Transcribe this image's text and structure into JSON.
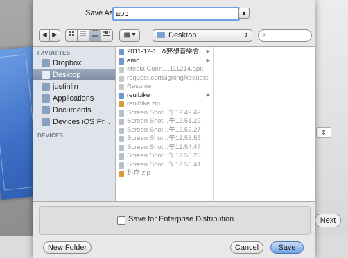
{
  "dialog": {
    "save_as_label": "Save As:",
    "save_as_value": "app",
    "expand_icon": "▲"
  },
  "toolbar": {
    "back": "◀",
    "forward": "▶",
    "arrange": "▦ ▾",
    "location": "Desktop",
    "location_chevron": "⇕",
    "search_icon": "⌕"
  },
  "sidebar": {
    "favorites_heading": "FAVORITES",
    "devices_heading": "DEVICES",
    "items": [
      {
        "label": "Dropbox",
        "icon": "folder-icon"
      },
      {
        "label": "Desktop",
        "icon": "desktop-icon",
        "selected": true
      },
      {
        "label": "justinlin",
        "icon": "home-icon"
      },
      {
        "label": "Applications",
        "icon": "applications-icon"
      },
      {
        "label": "Documents",
        "icon": "documents-icon"
      },
      {
        "label": "Devices   iOS Pr...",
        "icon": "folder-icon"
      }
    ]
  },
  "files": [
    {
      "name": "2011-12-1...&夢想音樂會",
      "type": "folder",
      "arrow": "▶"
    },
    {
      "name": "emc",
      "type": "folder",
      "arrow": "▶"
    },
    {
      "name": "Media Conn....111214.apk",
      "type": "file",
      "disabled": true
    },
    {
      "name": "request.certSigningRequest",
      "type": "file",
      "disabled": true
    },
    {
      "name": "Resume",
      "type": "file",
      "disabled": true
    },
    {
      "name": "reuibike",
      "type": "folder",
      "arrow": "▶"
    },
    {
      "name": "reuibike.zip",
      "type": "zip",
      "disabled": true
    },
    {
      "name": "Screen Shot...午12.49.42",
      "type": "img",
      "disabled": true
    },
    {
      "name": "Screen Shot...午12.51.22",
      "type": "img",
      "disabled": true
    },
    {
      "name": "Screen Shot...午12.52.27",
      "type": "img",
      "disabled": true
    },
    {
      "name": "Screen Shot...午12.53.55",
      "type": "img",
      "disabled": true
    },
    {
      "name": "Screen Shot...午12.54.47",
      "type": "img",
      "disabled": true
    },
    {
      "name": "Screen Shot...午12.55.23",
      "type": "img",
      "disabled": true
    },
    {
      "name": "Screen Shot...午12.55.41",
      "type": "img",
      "disabled": true
    },
    {
      "name": "封存.zip",
      "type": "zip",
      "disabled": true
    }
  ],
  "options": {
    "enterprise_label": "Save for Enterprise Distribution"
  },
  "footer": {
    "new_folder": "New Folder",
    "cancel": "Cancel",
    "save": "Save"
  },
  "background": {
    "next_label": "Next"
  }
}
